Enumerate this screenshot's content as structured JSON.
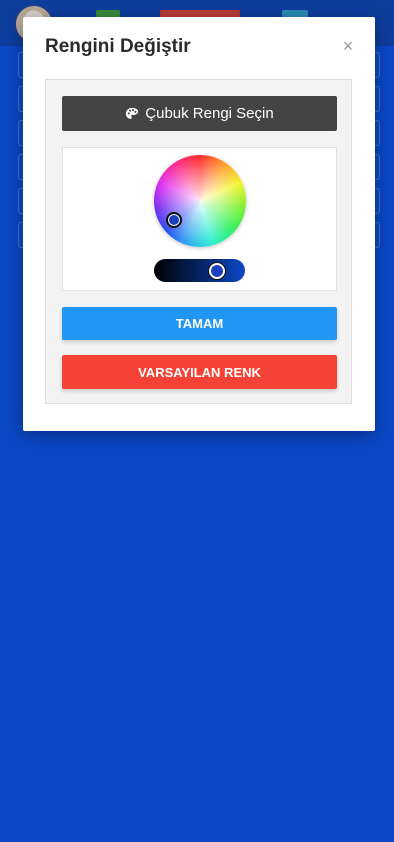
{
  "modal": {
    "title": "Rengini Değiştir",
    "close_label": "×",
    "pick_button_label": "Çubuk Rengi Seçin",
    "ok_button_label": "TAMAM",
    "default_button_label": "VARSAYILAN RENK"
  },
  "colors": {
    "background": "#0b48c6",
    "ok_button": "#2196f3",
    "default_button": "#f44336",
    "pick_button": "#444444",
    "selected_color": "#0b48c6"
  },
  "icons": {
    "pick_button_icon": "palette-icon",
    "close_icon": "close-icon"
  }
}
